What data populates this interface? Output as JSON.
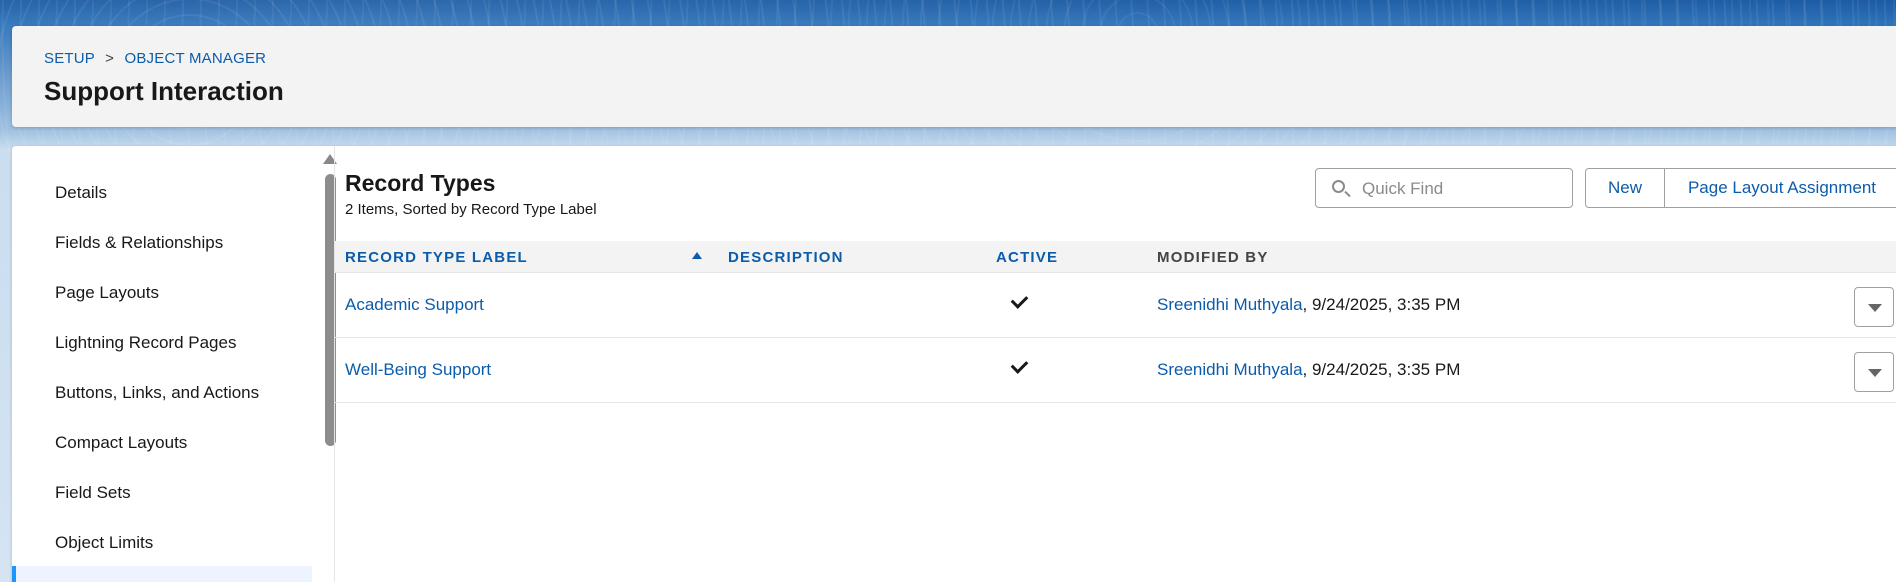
{
  "header": {
    "breadcrumb": {
      "setup": "SETUP",
      "separator": ">",
      "object_manager": "OBJECT MANAGER"
    },
    "title": "Support Interaction"
  },
  "sidebar": {
    "items": [
      {
        "label": "Details"
      },
      {
        "label": "Fields & Relationships"
      },
      {
        "label": "Page Layouts"
      },
      {
        "label": "Lightning Record Pages"
      },
      {
        "label": "Buttons, Links, and Actions"
      },
      {
        "label": "Compact Layouts"
      },
      {
        "label": "Field Sets"
      },
      {
        "label": "Object Limits"
      }
    ]
  },
  "main": {
    "title": "Record Types",
    "subtitle": "2 Items, Sorted by Record Type Label",
    "quick_find": {
      "placeholder": "Quick Find",
      "value": ""
    },
    "buttons": {
      "new": "New",
      "page_layout_assignment": "Page Layout Assignment"
    },
    "table": {
      "columns": {
        "label": "RECORD TYPE LABEL",
        "description": "DESCRIPTION",
        "active": "ACTIVE",
        "modified_by": "MODIFIED BY"
      },
      "sort": {
        "column": "RECORD TYPE LABEL",
        "direction": "ascending"
      },
      "rows": [
        {
          "label": "Academic Support",
          "description": "",
          "active": true,
          "modified_by": "Sreenidhi Muthyala",
          "modified_at": ", 9/24/2025, 3:35 PM"
        },
        {
          "label": "Well-Being Support",
          "description": "",
          "active": true,
          "modified_by": "Sreenidhi Muthyala",
          "modified_at": ", 9/24/2025, 3:35 PM"
        }
      ]
    }
  },
  "colors": {
    "link": "#0b5cab",
    "text": "#181818",
    "header_bg": "#f3f3f3",
    "brand_band": "#1b5fa8",
    "selected_accent": "#1b96ff"
  },
  "icons": {
    "search": "search-icon",
    "sort": "sort-ascending-icon",
    "active": "checkmark-icon",
    "row_menu": "chevron-down-icon"
  }
}
